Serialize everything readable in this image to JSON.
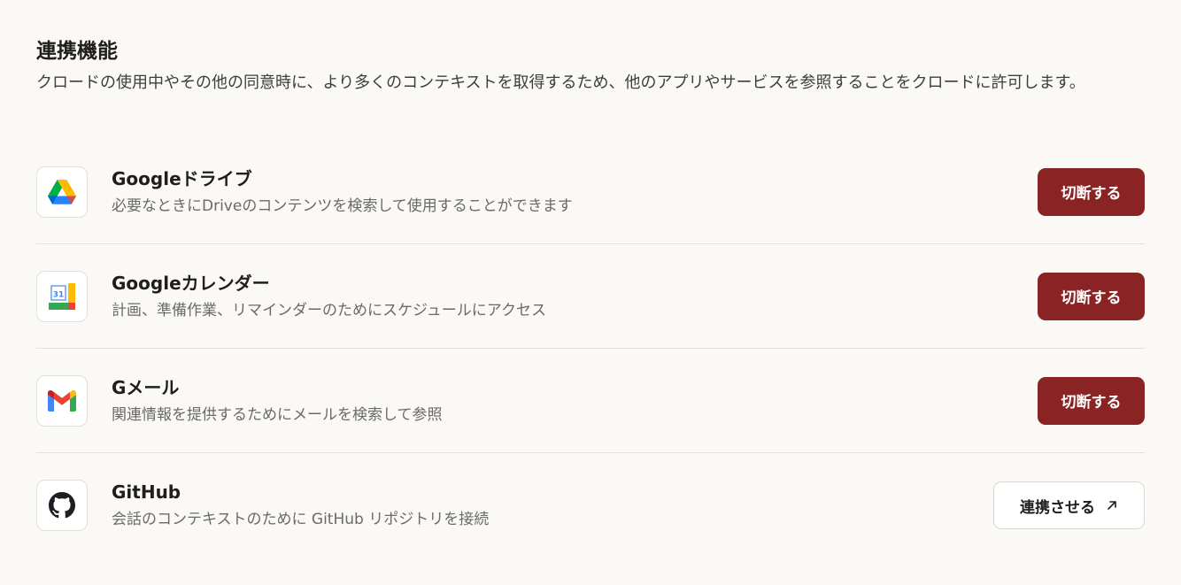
{
  "section": {
    "title": "連携機能",
    "description": "クロードの使用中やその他の同意時に、より多くのコンテキストを取得するため、他のアプリやサービスを参照することをクロードに許可します。"
  },
  "integrations": [
    {
      "name": "Googleドライブ",
      "description": "必要なときにDriveのコンテンツを検索して使用することができます",
      "icon": "google-drive-icon",
      "button_label": "切断する",
      "connected": true
    },
    {
      "name": "Googleカレンダー",
      "description": "計画、準備作業、リマインダーのためにスケジュールにアクセス",
      "icon": "google-calendar-icon",
      "icon_text": "31",
      "button_label": "切断する",
      "connected": true
    },
    {
      "name": "Gメール",
      "description": "関連情報を提供するためにメールを検索して参照",
      "icon": "gmail-icon",
      "button_label": "切断する",
      "connected": true
    },
    {
      "name": "GitHub",
      "description": "会話のコンテキストのために GitHub リポジトリを接続",
      "icon": "github-icon",
      "button_label": "連携させる",
      "button_icon": "external-arrow-icon",
      "connected": false
    }
  ],
  "colors": {
    "background": "#faf9f6",
    "disconnect_button": "#8a2424",
    "connect_button": "#ffffff",
    "divider": "#e3e1da"
  }
}
